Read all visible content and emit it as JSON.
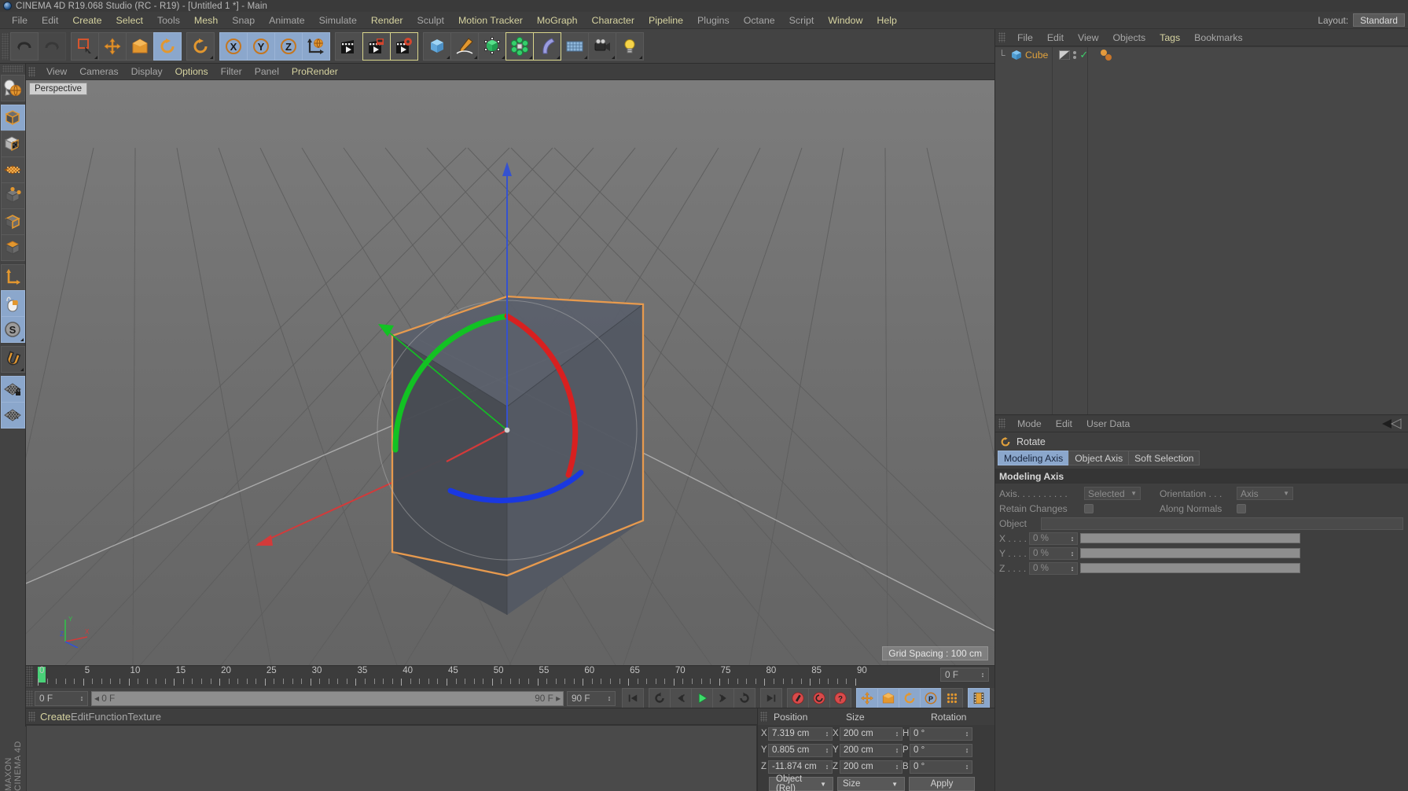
{
  "window": {
    "title": "CINEMA 4D R19.068 Studio (RC - R19) - [Untitled 1 *] - Main",
    "logo_icon": "cinema4d-logo-icon"
  },
  "layout": {
    "label": "Layout:",
    "value": "Standard"
  },
  "menubar": {
    "items": [
      {
        "label": "File",
        "style": "gray"
      },
      {
        "label": "Edit",
        "style": "gray"
      },
      {
        "label": "Create",
        "style": "gold"
      },
      {
        "label": "Select",
        "style": "gold"
      },
      {
        "label": "Tools",
        "style": "gray"
      },
      {
        "label": "Mesh",
        "style": "gold"
      },
      {
        "label": "Snap",
        "style": "gray"
      },
      {
        "label": "Animate",
        "style": "gray"
      },
      {
        "label": "Simulate",
        "style": "gray"
      },
      {
        "label": "Render",
        "style": "gold"
      },
      {
        "label": "Sculpt",
        "style": "gray"
      },
      {
        "label": "Motion Tracker",
        "style": "gold"
      },
      {
        "label": "MoGraph",
        "style": "gold"
      },
      {
        "label": "Character",
        "style": "gold"
      },
      {
        "label": "Pipeline",
        "style": "gold"
      },
      {
        "label": "Plugins",
        "style": "gray"
      },
      {
        "label": "Octane",
        "style": "gray"
      },
      {
        "label": "Script",
        "style": "gray"
      },
      {
        "label": "Window",
        "style": "gold"
      },
      {
        "label": "Help",
        "style": "gold"
      }
    ]
  },
  "toolbar": {
    "groups": [
      {
        "buttons": [
          {
            "icon": "undo-icon",
            "state": "normal"
          },
          {
            "icon": "redo-icon",
            "state": "disabled"
          }
        ]
      },
      {
        "buttons": [
          {
            "icon": "live-selection-icon",
            "state": "normal",
            "menu": true
          },
          {
            "icon": "move-tool-icon",
            "state": "normal"
          },
          {
            "icon": "scale-tool-icon",
            "state": "normal"
          },
          {
            "icon": "rotate-tool-icon",
            "state": "active"
          }
        ]
      },
      {
        "buttons": [
          {
            "icon": "rotate-axis-icon",
            "state": "normal",
            "menu": true
          }
        ]
      },
      {
        "buttons": [
          {
            "icon": "lock-x-axis-icon",
            "state": "active"
          },
          {
            "icon": "lock-y-axis-icon",
            "state": "active"
          },
          {
            "icon": "lock-z-axis-icon",
            "state": "active"
          },
          {
            "icon": "world-coordinates-icon",
            "state": "active"
          }
        ]
      },
      {
        "buttons": [
          {
            "icon": "render-view-icon",
            "state": "normal"
          },
          {
            "icon": "render-to-picture-viewer-icon",
            "state": "selected"
          },
          {
            "icon": "render-settings-icon",
            "state": "selected"
          }
        ]
      },
      {
        "buttons": [
          {
            "icon": "add-cube-object-icon",
            "state": "normal",
            "menu": true
          },
          {
            "icon": "add-spline-icon",
            "state": "normal",
            "menu": true
          },
          {
            "icon": "add-generator-icon",
            "state": "normal",
            "menu": true
          },
          {
            "icon": "add-deformer-icon",
            "state": "selected",
            "menu": true
          },
          {
            "icon": "add-bend-object-icon",
            "state": "selected",
            "menu": true
          },
          {
            "icon": "add-scene-object-icon",
            "state": "normal",
            "menu": true
          },
          {
            "icon": "add-camera-icon",
            "state": "normal",
            "menu": true
          },
          {
            "icon": "add-light-icon",
            "state": "normal",
            "menu": true
          }
        ]
      }
    ]
  },
  "left_toolbar": {
    "buttons": [
      {
        "icon": "viewport-camera-icon",
        "state": "normal"
      },
      {
        "icon": "model-mode-icon",
        "state": "active"
      },
      {
        "icon": "texture-mode-icon",
        "state": "normal"
      },
      {
        "icon": "polygon-mode-icon",
        "state": "normal"
      },
      {
        "icon": "point-mode-icon",
        "state": "normal"
      },
      {
        "icon": "edge-mode-icon",
        "state": "normal"
      },
      {
        "icon": "polygons-mode-icon",
        "state": "normal"
      },
      {
        "icon": "enable-axis-icon",
        "state": "normal"
      },
      {
        "icon": "viewport-solo-icon",
        "state": "active"
      },
      {
        "icon": "soft-selection-icon",
        "state": "active",
        "menu": true
      },
      {
        "icon": "snap-magnet-icon",
        "state": "normal",
        "menu": true
      },
      {
        "icon": "workplane-lock-icon",
        "state": "active"
      },
      {
        "icon": "workplane-icon",
        "state": "active"
      }
    ]
  },
  "viewport": {
    "menu": [
      {
        "label": "View",
        "style": "gray"
      },
      {
        "label": "Cameras",
        "style": "gray"
      },
      {
        "label": "Display",
        "style": "gray"
      },
      {
        "label": "Options",
        "style": "gold"
      },
      {
        "label": "Filter",
        "style": "gray"
      },
      {
        "label": "Panel",
        "style": "gray"
      },
      {
        "label": "ProRender",
        "style": "gold"
      }
    ],
    "perspective_label": "Perspective",
    "grid_spacing": "Grid Spacing : 100 cm",
    "axis_gizmo": {
      "x": "X",
      "y": "Y",
      "z": "Z"
    },
    "colors": {
      "background_top": "#787878",
      "background_bottom": "#6a6a6a",
      "grid_line": "#5e5e5e",
      "cube_face": "#4c5058",
      "selection_outline": "#e8a05a",
      "axis_x": "#e03b3b",
      "axis_y": "#3b6fe0",
      "axis_z": "#2fbf4a",
      "band_red": "#e02020",
      "band_green": "#12c223",
      "band_blue": "#1a38e0"
    }
  },
  "timeline": {
    "ruler_labels": [
      "0",
      "5",
      "10",
      "15",
      "20",
      "25",
      "30",
      "35",
      "40",
      "45",
      "50",
      "55",
      "60",
      "65",
      "70",
      "75",
      "80",
      "85",
      "90"
    ],
    "current_frame": "0 F",
    "range_start": "0 F",
    "range_end": "90 F",
    "max_frame": "90 F",
    "right_field": "0 F",
    "playhead_frame": 0,
    "buttons": [
      {
        "icon": "go-to-start-icon"
      },
      {
        "icon": "play-backwards-loop-icon"
      },
      {
        "icon": "previous-frame-icon"
      },
      {
        "icon": "play-icon"
      },
      {
        "icon": "next-frame-icon"
      },
      {
        "icon": "loop-playback-icon"
      },
      {
        "icon": "go-to-end-icon"
      },
      {
        "icon": "record-active-objects-icon"
      },
      {
        "icon": "autokeying-icon"
      },
      {
        "icon": "keyframe-selection-icon"
      },
      {
        "icon": "position-key-icon"
      },
      {
        "icon": "scale-key-icon"
      },
      {
        "icon": "rotation-key-icon"
      },
      {
        "icon": "parameter-key-icon"
      },
      {
        "icon": "point-level-animation-icon"
      },
      {
        "icon": "timeline-filmstrip-icon"
      }
    ]
  },
  "material_manager": {
    "menu": [
      {
        "label": "Create",
        "style": "gold"
      },
      {
        "label": "Edit",
        "style": "gray"
      },
      {
        "label": "Function",
        "style": "gray"
      },
      {
        "label": "Texture",
        "style": "gray"
      }
    ]
  },
  "coordinates": {
    "headers": [
      "Position",
      "Size",
      "Rotation"
    ],
    "rows": [
      {
        "pos_label": "X",
        "pos_value": "7.319 cm",
        "size_label": "X",
        "size_value": "200 cm",
        "rot_label": "H",
        "rot_value": "0 °"
      },
      {
        "pos_label": "Y",
        "pos_value": "0.805 cm",
        "size_label": "Y",
        "size_value": "200 cm",
        "rot_label": "P",
        "rot_value": "0 °"
      },
      {
        "pos_label": "Z",
        "pos_value": "-11.874 cm",
        "size_label": "Z",
        "size_value": "200 cm",
        "rot_label": "B",
        "rot_value": "0 °"
      }
    ],
    "mode_select": "Object (Rel)",
    "size_select": "Size",
    "apply_button": "Apply"
  },
  "object_manager": {
    "menu": [
      {
        "label": "File",
        "style": "gray"
      },
      {
        "label": "Edit",
        "style": "gray"
      },
      {
        "label": "View",
        "style": "gray"
      },
      {
        "label": "Objects",
        "style": "gray"
      },
      {
        "label": "Tags",
        "style": "gold"
      },
      {
        "label": "Bookmarks",
        "style": "gray"
      }
    ],
    "objects": [
      {
        "name": "Cube",
        "icon": "cube-object-icon",
        "visibility_editor_icon": "visibility-dot-icon",
        "visibility_render_icon": "visibility-dot-icon",
        "enabled_icon": "green-check-icon",
        "tag_icon": "phong-tag-icon"
      }
    ]
  },
  "attribute_manager": {
    "menu": [
      {
        "label": "Mode",
        "style": "gray"
      },
      {
        "label": "Edit",
        "style": "gray"
      },
      {
        "label": "User Data",
        "style": "gray"
      }
    ],
    "collapse_icon": "collapse-arrow-icon",
    "tool_icon": "rotate-tool-icon",
    "tool_title": "Rotate",
    "tabs": [
      {
        "label": "Modeling Axis",
        "active": true
      },
      {
        "label": "Object Axis",
        "active": false
      },
      {
        "label": "Soft Selection",
        "active": false
      }
    ],
    "section_title": "Modeling Axis",
    "fields": {
      "axis_label": "Axis. . . . . . . . . .",
      "axis_value": "Selected",
      "orientation_label": "Orientation . . .",
      "orientation_value": "Axis",
      "retain_changes_label": "Retain Changes",
      "retain_changes_checked": false,
      "along_normals_label": "Along Normals",
      "along_normals_checked": false,
      "object_label": "Object",
      "object_value": "",
      "x_label": "X . . . .",
      "x_value": "0 %",
      "y_label": "Y . . . .",
      "y_value": "0 %",
      "z_label": "Z . . . .",
      "z_value": "0 %"
    }
  },
  "brand": {
    "text": "MAXON CINEMA 4D"
  }
}
